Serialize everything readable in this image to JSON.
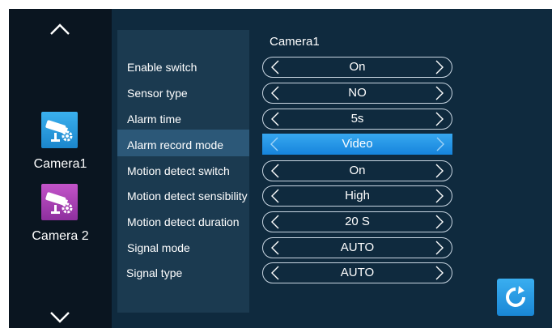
{
  "sidebar": {
    "cameras": [
      {
        "label": "Camera1"
      },
      {
        "label": "Camera 2"
      }
    ]
  },
  "settings": {
    "title": "Camera1",
    "rows": [
      {
        "label": "Enable switch",
        "value": "On"
      },
      {
        "label": "Sensor type",
        "value": "NO"
      },
      {
        "label": "Alarm time",
        "value": "5s"
      },
      {
        "label": "Alarm record mode",
        "value": "Video"
      },
      {
        "label": "Motion detect switch",
        "value": "On"
      },
      {
        "label": "Motion detect sensibility",
        "value": "High"
      },
      {
        "label": "Motion detect duration",
        "value": "20 S"
      },
      {
        "label": "Signal mode",
        "value": "AUTO"
      },
      {
        "label": "Signal type",
        "value": "AUTO"
      }
    ],
    "selected_row": "Alarm record mode"
  },
  "colors": {
    "background": "#0f2a3e",
    "sidebar": "#0a1520",
    "label_panel": "#1b3a50",
    "highlight_row": "#2c5878",
    "accent_blue": "#1e90e8",
    "camera2_icon": "#a63db4"
  },
  "icons": {
    "up": "chevron-up-icon",
    "down": "chevron-down-icon",
    "camera1": "camera-settings-icon",
    "camera2": "camera-settings-icon",
    "refresh": "refresh-icon"
  }
}
